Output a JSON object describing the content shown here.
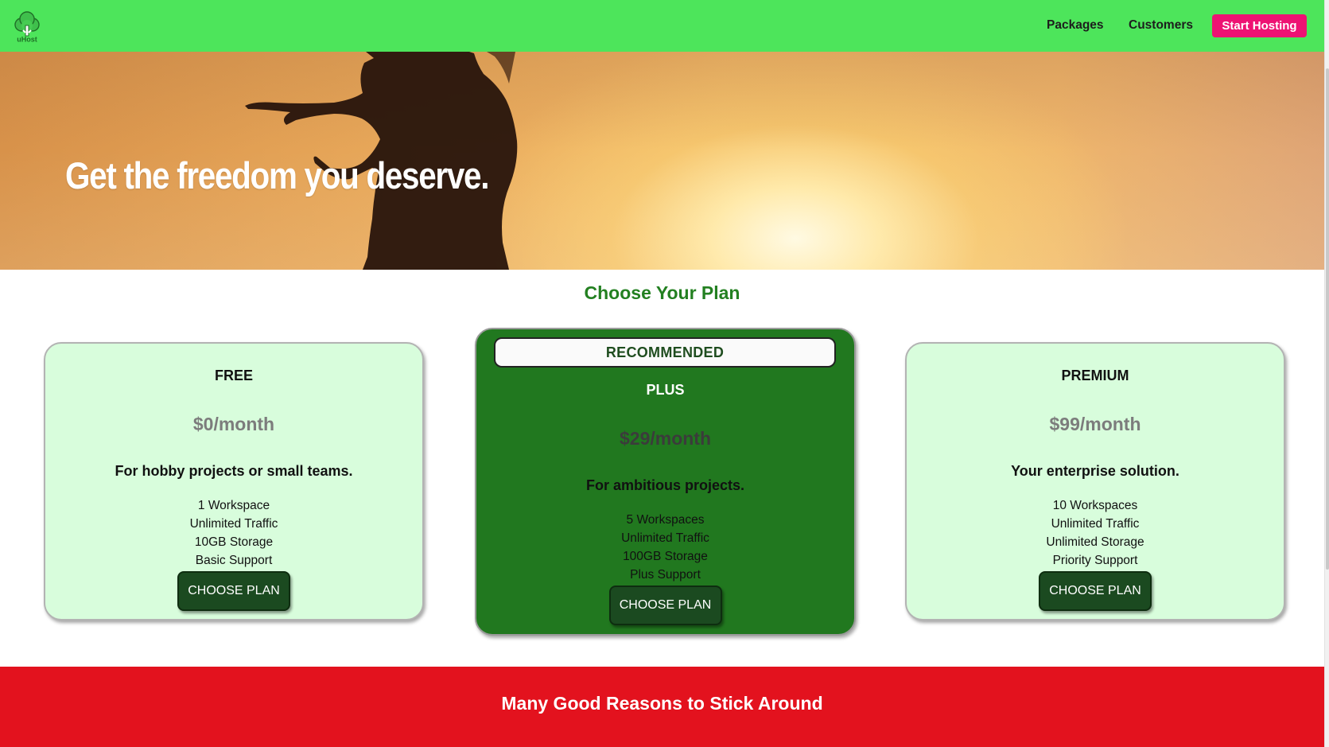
{
  "header": {
    "logo_text": "uHost",
    "nav": {
      "packages": "Packages",
      "customers": "Customers",
      "cta": "Start Hosting"
    },
    "colors": {
      "bar": "#4de55b",
      "cta": "#ee1273"
    }
  },
  "hero": {
    "title": "Get the freedom you deserve."
  },
  "plans": {
    "section_title": "Choose Your Plan",
    "items": [
      {
        "name": "FREE",
        "price": "$0/month",
        "description": "For hobby projects or small teams.",
        "features": [
          "1 Workspace",
          "Unlimited Traffic",
          "10GB Storage",
          "Basic Support"
        ],
        "button": "CHOOSE PLAN"
      },
      {
        "badge": "RECOMMENDED",
        "name": "PLUS",
        "price": "$29/month",
        "description": "For ambitious projects.",
        "features": [
          "5 Workspaces",
          "Unlimited Traffic",
          "100GB Storage",
          "Plus Support"
        ],
        "button": "CHOOSE PLAN"
      },
      {
        "name": "PREMIUM",
        "price": "$99/month",
        "description": "Your enterprise solution.",
        "features": [
          "10 Workspaces",
          "Unlimited Traffic",
          "Unlimited Storage",
          "Priority Support"
        ],
        "button": "CHOOSE PLAN"
      }
    ],
    "colors": {
      "card": "#d8fddc",
      "featured": "#21781f",
      "button": "#1b4a20",
      "title": "#238021"
    }
  },
  "reasons": {
    "title": "Many Good Reasons to Stick Around",
    "color": "#e3121e"
  }
}
